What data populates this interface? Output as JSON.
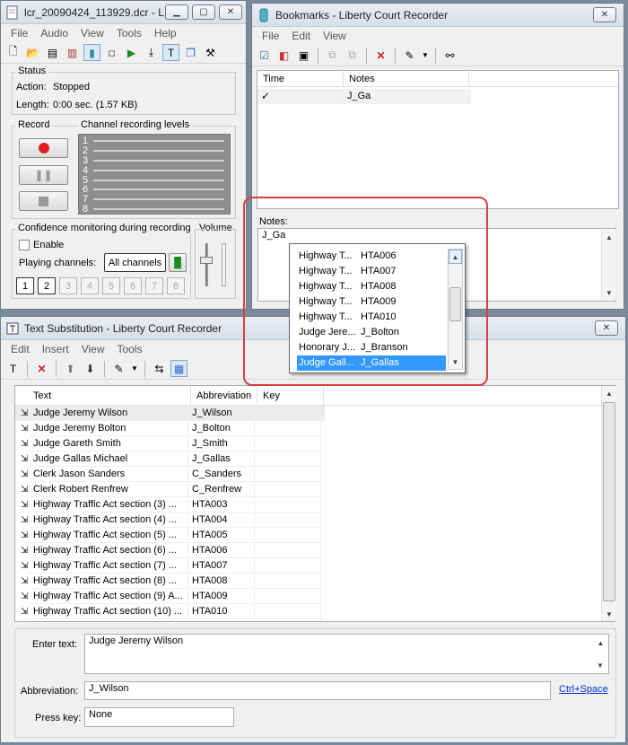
{
  "main": {
    "title": "lcr_20090424_113929.dcr - L...",
    "menu": [
      "File",
      "Audio",
      "View",
      "Tools",
      "Help"
    ],
    "status": {
      "group": "Status",
      "action_label": "Action:",
      "action_value": "Stopped",
      "length_label": "Length:",
      "length_value": "0:00 sec. (1.57 KB)"
    },
    "record_label": "Record",
    "levels_label": "Channel recording levels",
    "channel_numbers": [
      "1",
      "2",
      "3",
      "4",
      "5",
      "6",
      "7",
      "8"
    ],
    "confidence_label": "Confidence monitoring during recording",
    "enable_label": "Enable",
    "playing_label": "Playing channels:",
    "all_channels": "All channels",
    "volume_label": "Volume"
  },
  "bookmarks": {
    "title": "Bookmarks - Liberty Court Recorder",
    "menu": [
      "File",
      "Edit",
      "View"
    ],
    "columns": [
      "Time",
      "Notes"
    ],
    "rows": [
      {
        "time": "✓",
        "notes": "J_Ga"
      }
    ],
    "notes_label": "Notes:",
    "notes_value": "J_Ga"
  },
  "autocomplete": {
    "items": [
      {
        "text": "Highway T...",
        "abbr": "HTA006"
      },
      {
        "text": "Highway T...",
        "abbr": "HTA007"
      },
      {
        "text": "Highway T...",
        "abbr": "HTA008"
      },
      {
        "text": "Highway T...",
        "abbr": "HTA009"
      },
      {
        "text": "Highway T...",
        "abbr": "HTA010"
      },
      {
        "text": "Judge Jere...",
        "abbr": "J_Bolton"
      },
      {
        "text": "Honorary J...",
        "abbr": "J_Branson"
      },
      {
        "text": "Judge Gall...",
        "abbr": "J_Gallas"
      }
    ],
    "selected_index": 7
  },
  "textsub": {
    "title": "Text Substitution - Liberty Court Recorder",
    "menu": [
      "Edit",
      "Insert",
      "View",
      "Tools"
    ],
    "columns": [
      "Text",
      "Abbreviation",
      "Key"
    ],
    "rows": [
      {
        "text": "Judge Jeremy Wilson",
        "abbr": "J_Wilson",
        "key": ""
      },
      {
        "text": "Judge Jeremy Bolton",
        "abbr": "J_Bolton",
        "key": ""
      },
      {
        "text": "Judge Gareth Smith",
        "abbr": "J_Smith",
        "key": ""
      },
      {
        "text": "Judge Gallas Michael",
        "abbr": "J_Gallas",
        "key": ""
      },
      {
        "text": "Clerk Jason Sanders",
        "abbr": "C_Sanders",
        "key": ""
      },
      {
        "text": "Clerk Robert Renfrew",
        "abbr": "C_Renfrew",
        "key": ""
      },
      {
        "text": "Highway Traffic Act section (3) ...",
        "abbr": "HTA003",
        "key": ""
      },
      {
        "text": "Highway Traffic Act section (4) ...",
        "abbr": "HTA004",
        "key": ""
      },
      {
        "text": "Highway Traffic Act section (5) ...",
        "abbr": "HTA005",
        "key": ""
      },
      {
        "text": "Highway Traffic Act section (6) ...",
        "abbr": "HTA006",
        "key": ""
      },
      {
        "text": "Highway Traffic Act section (7) ...",
        "abbr": "HTA007",
        "key": ""
      },
      {
        "text": "Highway Traffic Act section (8) ...",
        "abbr": "HTA008",
        "key": ""
      },
      {
        "text": "Highway Traffic Act section (9) A...",
        "abbr": "HTA009",
        "key": ""
      },
      {
        "text": "Highway Traffic Act section (10) ...",
        "abbr": "HTA010",
        "key": ""
      }
    ],
    "enter_text_label": "Enter text:",
    "enter_text_value": "Judge Jeremy Wilson",
    "abbr_label": "Abbreviation:",
    "abbr_value": "J_Wilson",
    "shortcut_link": "Ctrl+Space",
    "press_key_label": "Press key:",
    "press_key_value": "None"
  },
  "colors": {
    "selection": "#3399ff",
    "highlight_outline": "#d84040",
    "link": "#0033cc",
    "record_red": "#e02020"
  }
}
